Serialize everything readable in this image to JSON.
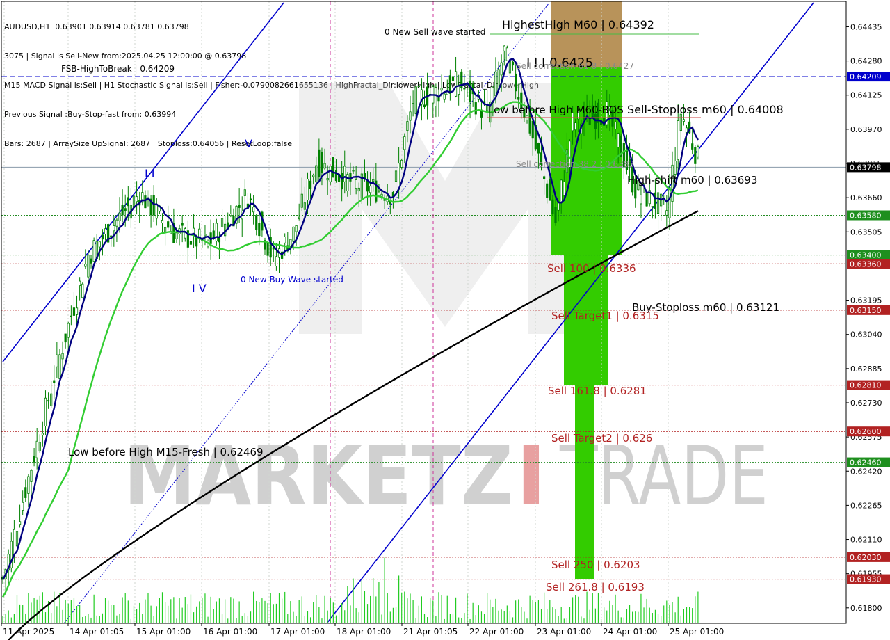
{
  "info_lines": [
    "AUDUSD,H1  0.63901 0.63914 0.63781 0.63798",
    "3075 | Signal is Sell-New from:2025.04.25 12:00:00 @ 0.63798",
    "M15 MACD Signal is:Sell | H1 Stochastic Signal is:Sell | Fisher:-0.0790082661655136 | HighFractal_Dir:lowerHigh | LowFractal_Dir:lowerHigh",
    "Previous Signal :Buy-Stop-fast from: 0.63994",
    "Bars: 2687 | ArraySize UpSignal: 2687 | Stoploss:0.64056 | ResetLoop:false"
  ],
  "colors": {
    "background": "#ffffff",
    "candle": "#008000",
    "ma_fast": "#000080",
    "ma_mid": "#32cd32",
    "ma_slow": "#000000",
    "channel": "#0000cd",
    "level_red": "#b22222",
    "level_green": "#228b22",
    "level_blue": "#0000cd",
    "zone_green": "#33cc00",
    "zone_tan": "#b8935a",
    "watermark": "#d0d0d0",
    "watermark_red": "#e8a0a0",
    "price_tag_red": "#b22222",
    "price_tag_green": "#1e8f1e",
    "price_tag_blue": "#0000cd",
    "price_tag_black": "#000000"
  },
  "chart_data": {
    "type": "candlestick",
    "symbol": "AUDUSD",
    "timeframe": "H1",
    "ylim": [
      0.6173,
      0.6455
    ],
    "x_ticks": [
      "11 Apr 2025",
      "14 Apr 01:05",
      "15 Apr 01:00",
      "16 Apr 01:00",
      "17 Apr 01:00",
      "18 Apr 01:00",
      "21 Apr 01:05",
      "22 Apr 01:00",
      "23 Apr 01:00",
      "24 Apr 01:00",
      "25 Apr 01:00"
    ],
    "y_ticks": [
      "0.64435",
      "0.64280",
      "0.64125",
      "0.63970",
      "0.63815",
      "0.63660",
      "0.63505",
      "0.63195",
      "0.63040",
      "0.62885",
      "0.62730",
      "0.62575",
      "0.62420",
      "0.62265",
      "0.62110",
      "0.61955",
      "0.61800"
    ],
    "price_tags": [
      {
        "label": "0.64209",
        "value": 0.64209,
        "style": "blue"
      },
      {
        "label": "0.63798",
        "value": 0.63798,
        "style": "black"
      },
      {
        "label": "0.63580",
        "value": 0.6358,
        "style": "green"
      },
      {
        "label": "0.63400",
        "value": 0.634,
        "style": "green"
      },
      {
        "label": "0.63360",
        "value": 0.6336,
        "style": "red"
      },
      {
        "label": "0.63150",
        "value": 0.6315,
        "style": "red"
      },
      {
        "label": "0.62810",
        "value": 0.6281,
        "style": "red"
      },
      {
        "label": "0.62600",
        "value": 0.626,
        "style": "red"
      },
      {
        "label": "0.62460",
        "value": 0.6246,
        "style": "green"
      },
      {
        "label": "0.62030",
        "value": 0.6203,
        "style": "red"
      },
      {
        "label": "0.61930",
        "value": 0.6193,
        "style": "red"
      }
    ],
    "levels": [
      {
        "value": 0.64209,
        "style": "blue-dash"
      },
      {
        "value": 0.63798,
        "style": "grey"
      },
      {
        "value": 0.6358,
        "style": "green-dot"
      },
      {
        "value": 0.634,
        "style": "green-dot"
      },
      {
        "value": 0.6336,
        "style": "red-dot"
      },
      {
        "value": 0.6315,
        "style": "red-dot"
      },
      {
        "value": 0.6281,
        "style": "red-dot"
      },
      {
        "value": 0.626,
        "style": "red-dot"
      },
      {
        "value": 0.6246,
        "style": "green-dot"
      },
      {
        "value": 0.6203,
        "style": "red-dot"
      },
      {
        "value": 0.6193,
        "style": "red-dot"
      }
    ],
    "annotations": [
      {
        "text": "FSB-HighToBreak | 0.64209",
        "value": 0.64209,
        "color": "black"
      },
      {
        "text": "HighestHigh    M60 | 0.64392",
        "value": 0.64392,
        "color": "black"
      },
      {
        "text": "0 New Sell wave started",
        "value": 0.64355,
        "color": "black"
      },
      {
        "text": "I I I 0.6425",
        "value": 0.6425,
        "color": "black"
      },
      {
        "text": "Sell correction 61.8 | 0.6427",
        "value": 0.64227,
        "color": "grey"
      },
      {
        "text": "Low before High   M60-BOS",
        "value": 0.64008,
        "color": "black"
      },
      {
        "text": "Sell-Stoploss m60 | 0.64008",
        "value": 0.64008,
        "color": "black"
      },
      {
        "text": "Sell correction 38.2 | 0.6383",
        "value": 0.6383,
        "color": "grey"
      },
      {
        "text": "High-shift m60 | 0.63693",
        "value": 0.63693,
        "color": "black"
      },
      {
        "text": "0 New Buy Wave started",
        "value": 0.6328,
        "color": "blue"
      },
      {
        "text": "Sell 100 | 0.6336",
        "value": 0.6336,
        "color": "red"
      },
      {
        "text": "Buy-Stoploss m60 | 0.63121",
        "value": 0.63121,
        "color": "black"
      },
      {
        "text": "Sell Target1 | 0.6315",
        "value": 0.6315,
        "color": "red"
      },
      {
        "text": "Sell 161.8 | 0.6281",
        "value": 0.6281,
        "color": "red"
      },
      {
        "text": "Sell Target2 | 0.626",
        "value": 0.626,
        "color": "red"
      },
      {
        "text": "Low before High    M15-Fresh | 0.62469",
        "value": 0.62469,
        "color": "black"
      },
      {
        "text": "Sell  250 | 0.6203",
        "value": 0.6203,
        "color": "red"
      },
      {
        "text": "Sell  261.8 | 0.6193",
        "value": 0.6193,
        "color": "red"
      },
      {
        "text": "I I",
        "value": 0.6377,
        "color": "blue"
      },
      {
        "text": "V",
        "value": 0.6395,
        "color": "blue"
      },
      {
        "text": "I V",
        "value": 0.6322,
        "color": "blue"
      }
    ],
    "watermark": {
      "left": "MARKETZ",
      "accent": "I",
      "right": "TRADE"
    },
    "candles": [],
    "candle_spec": {
      "count": 245,
      "start": 0.6193,
      "seed": 7
    }
  }
}
